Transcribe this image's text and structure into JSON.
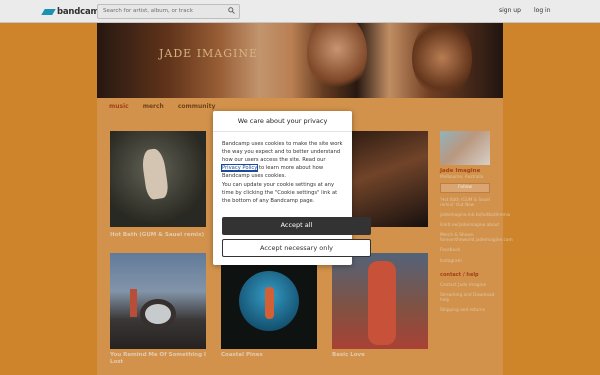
{
  "topbar": {
    "logo": "bandcamp",
    "search_placeholder": "Search for artist, album, or track",
    "signup": "sign up",
    "login": "log in"
  },
  "banner": {
    "title": "JADE IMAGINE"
  },
  "tabs": [
    "music",
    "merch",
    "community"
  ],
  "albums": [
    {
      "title": "Hot Bath (GUM & Sauel remix)"
    },
    {
      "title": "You Remind Me Of Something I Lost"
    },
    {
      "title": "Coastal Pines"
    },
    {
      "title": "Basic Love"
    }
  ],
  "sidebar": {
    "artist_name": "Jade Imagine",
    "location": "Melbourne, Australia",
    "follow": "Follow",
    "news": "'Hot Bath (GUM & Sauel remix)' Out Now",
    "links": [
      "jadeimagine.lnk.to/hotbathremix",
      "linktr.ee/jadeimagine.about",
      "Merch & Shows: forevertheworld.jadeimagine.com",
      "Facebook",
      "Instagram"
    ],
    "contact_heading": "contact / help",
    "contact_links": [
      "Contact Jade Imagine",
      "Streaming and Download help",
      "Shipping and returns"
    ]
  },
  "modal": {
    "title": "We care about your privacy",
    "p1_before": "Bandcamp uses cookies to make the site work the way you expect and to better understand how our users access the site. Read our ",
    "p1_link": "Privacy Policy",
    "p1_after": " to learn more about how Bandcamp uses cookies.",
    "p2": "You can update your cookie settings at any time by clicking the \"Cookie settings\" link at the bottom of any Bandcamp page.",
    "accept_all": "Accept all",
    "accept_necessary": "Accept necessary only"
  },
  "colors": {
    "page_bg": "#e0902e",
    "accent": "#b0471a",
    "logo": "#1da0c3",
    "button_dark": "#333333"
  }
}
